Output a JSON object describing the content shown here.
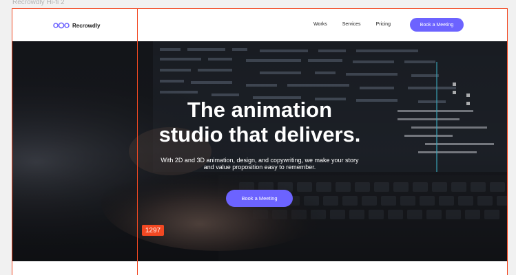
{
  "canvas": {
    "frame_label": "Recrowdly Hi-fi 2",
    "measurement_badge": "1297",
    "guide_color": "#f24822"
  },
  "brand": {
    "name": "Recrowdly",
    "logo_icon": "linked-circles-logo",
    "accent_color": "#6c63ff"
  },
  "nav": {
    "links": [
      "Works",
      "Services",
      "Pricing"
    ],
    "cta_label": "Book a Meeting"
  },
  "hero": {
    "title_line1": "The animation",
    "title_line2": "studio that delivers.",
    "subtitle_line1": "With 2D and 3D animation, design, and copywriting, we make your story",
    "subtitle_line2": "and value proposition easy to remember.",
    "cta_label": "Book a Meeting",
    "background_image": "dark-photo-hands-typing-on-laptop-with-timeline-editor"
  }
}
